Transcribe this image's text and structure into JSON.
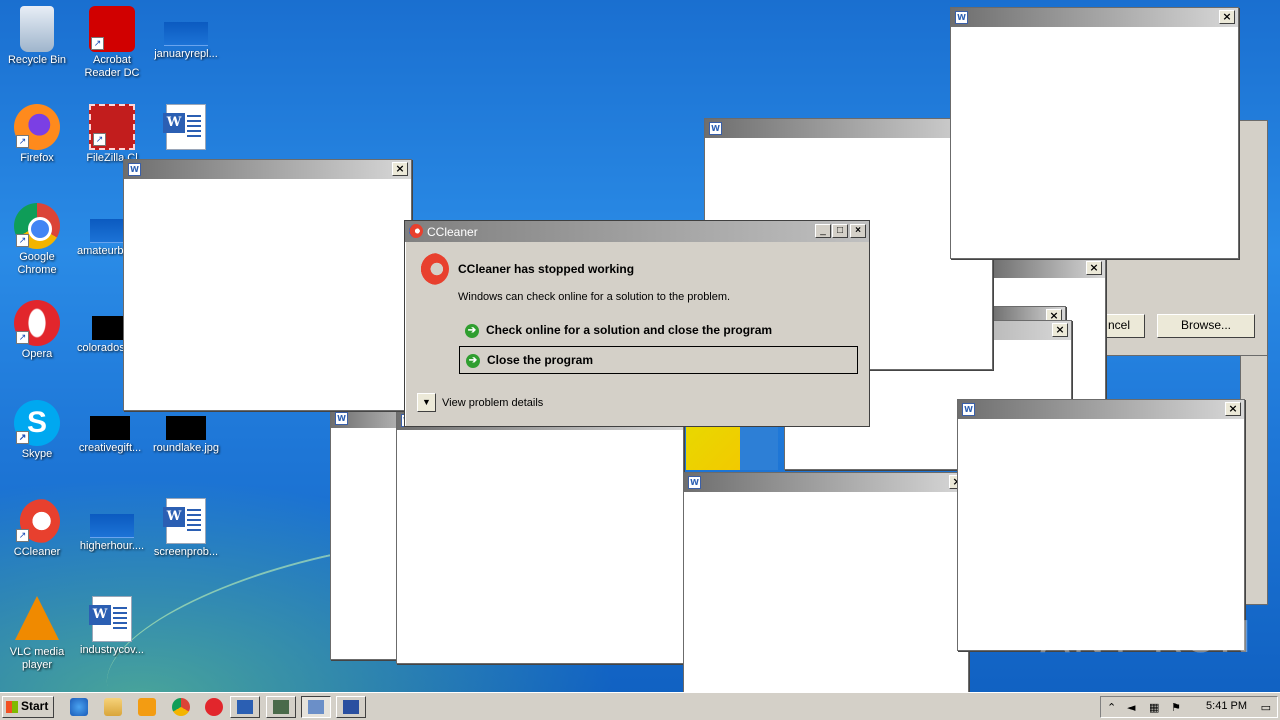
{
  "desktop": {
    "icons": [
      {
        "label": "Recycle Bin"
      },
      {
        "label": "Acrobat Reader DC"
      },
      {
        "label": "januaryrepl..."
      },
      {
        "label": "Firefox"
      },
      {
        "label": "FileZilla Cl"
      },
      {
        "label": "Google Chrome"
      },
      {
        "label": "amateurb"
      },
      {
        "label": "Opera"
      },
      {
        "label": "colorados"
      },
      {
        "label": "Skype"
      },
      {
        "label": "creativegift..."
      },
      {
        "label": "roundlake.jpg"
      },
      {
        "label": "CCleaner"
      },
      {
        "label": "higherhour...."
      },
      {
        "label": "screenprob..."
      },
      {
        "label": "VLC media player"
      },
      {
        "label": "industrycov..."
      }
    ]
  },
  "background_dialog": {
    "cancel_label": "ncel",
    "browse_label": "Browse..."
  },
  "ccleaner_dialog": {
    "title": "CCleaner",
    "heading": "CCleaner has stopped working",
    "message": "Windows can check online for a solution to the problem.",
    "option_check_online": "Check online for a solution and close the program",
    "option_close": "Close the program",
    "details_label": "View problem details",
    "minimize": "_",
    "maximize": "□",
    "close": "×"
  },
  "taskbar": {
    "start_label": "Start",
    "clock": "5:41 PM"
  },
  "watermark": "ANY RUN",
  "colors": {
    "desktop_blue": "#1f78d8",
    "dialog_gray": "#d4d0c8",
    "titlebar_gray": "#808080"
  }
}
